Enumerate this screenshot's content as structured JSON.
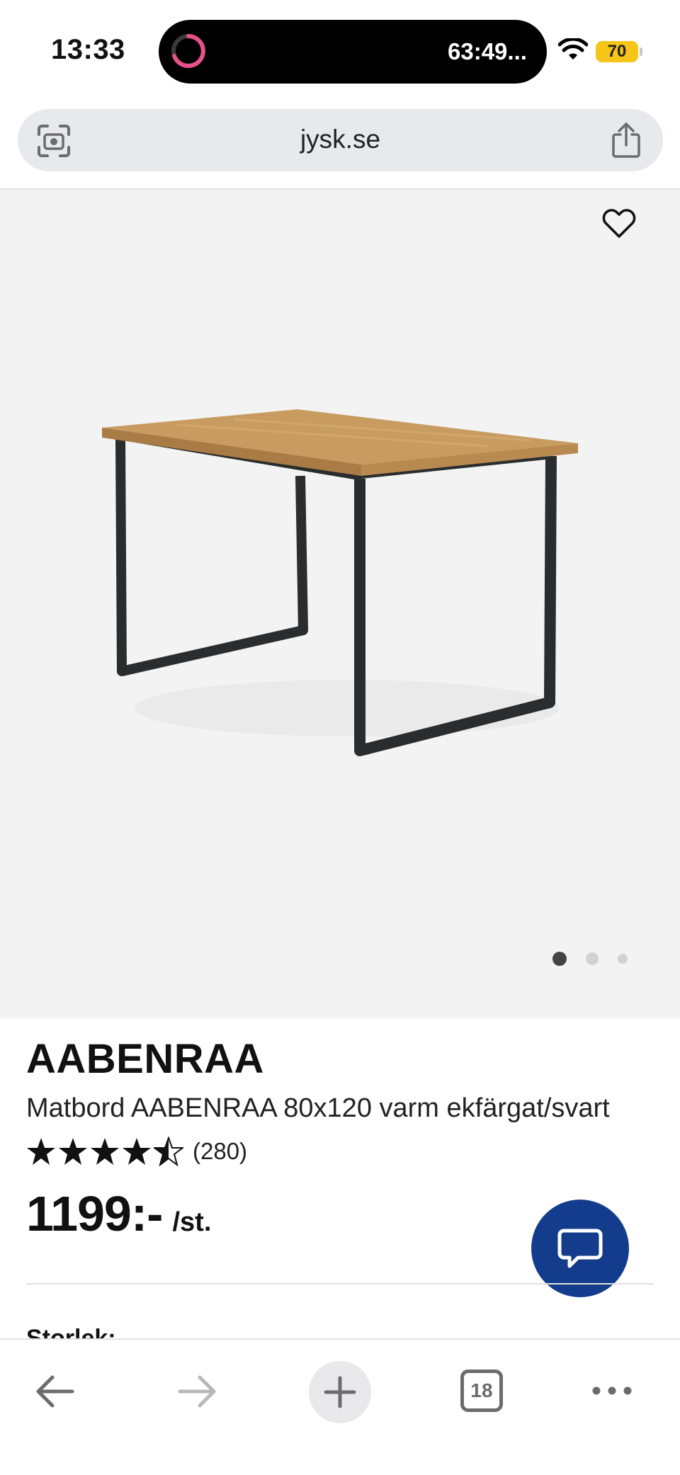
{
  "status_bar": {
    "time": "13:33",
    "timer": "63:49...",
    "battery": "70",
    "colors": {
      "battery": "#f5c518",
      "timer_ring": "#e8508c"
    }
  },
  "browser": {
    "url": "jysk.se",
    "icons": [
      "camera-scan-icon",
      "share-icon"
    ]
  },
  "product": {
    "brand": "AABENRAA",
    "description": "Matbord AABENRAA 80x120 varm ekfärgat/svart",
    "rating_value": 4.5,
    "rating_count": "(280)",
    "price": "1199:-",
    "price_unit": "/st.",
    "size_label": "Storlek:",
    "gallery": {
      "image_count": 3,
      "active_index": 0
    },
    "colors": {
      "chat_button": "#143c8c",
      "background": "#f3f3f3"
    }
  },
  "toolbar": {
    "tab_count": "18",
    "icons": [
      "back-arrow-icon",
      "forward-arrow-icon",
      "plus-icon",
      "tabs-icon",
      "more-icon"
    ]
  }
}
